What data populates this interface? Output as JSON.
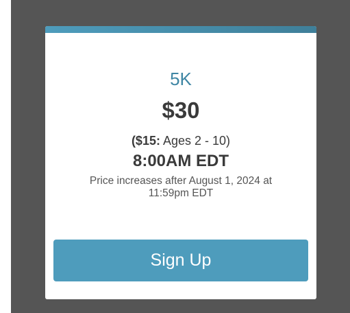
{
  "card": {
    "race_name": "5K",
    "price": "$30",
    "child_price_amount": "($15:",
    "child_price_ages": "Ages 2 - 10)",
    "start_time": "8:00AM EDT",
    "price_note_line1": "Price increases after August 1, 2024 at",
    "price_note_line2": "11:59pm EDT",
    "signup_label": "Sign Up"
  },
  "colors": {
    "accent": "#4e9cbc",
    "backdrop": "#555555",
    "text_dark": "#3a3a3a"
  }
}
